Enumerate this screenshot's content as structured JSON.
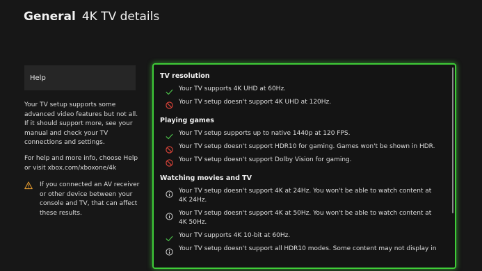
{
  "header": {
    "section": "General",
    "page": "4K TV details"
  },
  "sidebar": {
    "help_label": "Help",
    "description": "Your TV setup supports some advanced video features but not all. If it should support more, see your manual and check your TV connections and settings.",
    "help_info": "For help and more info, choose Help or visit xbox.com/xboxone/4k",
    "warning": "If you connected an AV receiver or other device between your console and TV, that can affect these results."
  },
  "groups": [
    {
      "title": "TV resolution",
      "items": [
        {
          "status": "supported",
          "icon": "checkmark-icon",
          "text": "Your TV supports 4K UHD at 60Hz."
        },
        {
          "status": "unsupported",
          "icon": "not-supported-icon",
          "text": "Your TV setup doesn't support 4K UHD at 120Hz."
        }
      ]
    },
    {
      "title": "Playing games",
      "items": [
        {
          "status": "supported",
          "icon": "checkmark-icon",
          "text": "Your TV setup supports up to native 1440p at 120 FPS."
        },
        {
          "status": "unsupported",
          "icon": "not-supported-icon",
          "text": "Your TV setup doesn't support HDR10 for gaming. Games won't be shown in HDR."
        },
        {
          "status": "unsupported",
          "icon": "not-supported-icon",
          "text": "Your TV setup doesn't support Dolby Vision for gaming."
        }
      ]
    },
    {
      "title": "Watching movies and TV",
      "items": [
        {
          "status": "info",
          "icon": "info-icon",
          "text": "Your TV setup doesn't support 4K at 24Hz. You won't be able to watch content at 4K 24Hz."
        },
        {
          "status": "info",
          "icon": "info-icon",
          "text": "Your TV setup doesn't support 4K at 50Hz. You won't be able to watch content at 4K 50Hz."
        },
        {
          "status": "supported",
          "icon": "checkmark-icon",
          "text": "Your TV supports 4K 10-bit at 60Hz."
        },
        {
          "status": "info",
          "icon": "info-icon",
          "text": "Your TV setup doesn't support all HDR10 modes. Some content may not display in"
        }
      ]
    }
  ],
  "colors": {
    "accent_green": "#3fcc38",
    "check_green": "#4cc24a",
    "error_red": "#e0453a",
    "warning_orange": "#e39a2f"
  }
}
